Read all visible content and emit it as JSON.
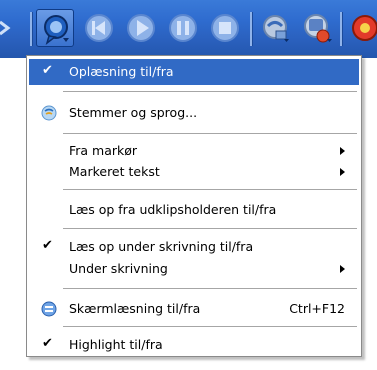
{
  "toolbar": {
    "buttons": [
      {
        "name": "speech-bubble-icon",
        "pressed": true
      },
      {
        "name": "rewind-icon"
      },
      {
        "name": "play-icon"
      },
      {
        "name": "pause-icon"
      },
      {
        "name": "stop-icon"
      },
      {
        "name": "reader-icon"
      },
      {
        "name": "settings-icon"
      },
      {
        "name": "help-icon"
      }
    ]
  },
  "menu": {
    "items": [
      {
        "label": "Oplæsning til/fra",
        "checked": true,
        "highlighted": true
      },
      {
        "label": "Stemmer og sprog...",
        "icon": "voice-icon"
      },
      {
        "label": "Fra markør",
        "submenu": true
      },
      {
        "label": "Markeret tekst",
        "submenu": true
      },
      {
        "label": "Læs op fra udklipsholderen til/fra"
      },
      {
        "label": "Læs op under skrivning til/fra",
        "checked": true
      },
      {
        "label": "Under skrivning",
        "submenu": true
      },
      {
        "label": "Skærmlæsning til/fra",
        "icon": "screen-icon",
        "shortcut": "Ctrl+F12"
      },
      {
        "label": "Highlight til/fra",
        "checked": true
      }
    ],
    "check_glyph": "✔"
  },
  "colors": {
    "toolbar_blue": "#2f6ccf",
    "highlight": "#316ac5"
  }
}
